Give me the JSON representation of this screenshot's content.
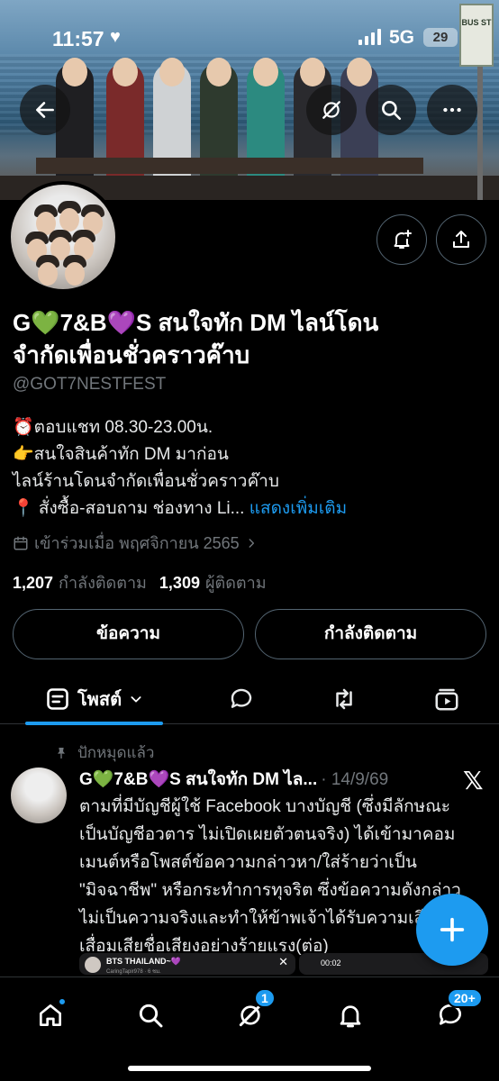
{
  "status_bar": {
    "time": "11:57",
    "network": "5G",
    "battery": "29"
  },
  "profile": {
    "display_name_line1": "G💚7&B💜S สนใจทัก DM ไลน์โดน",
    "display_name_line2": "จำกัดเพื่อนชั่วคราวค๊าบ",
    "handle": "@GOT7NESTFEST",
    "bio_lines": [
      "⏰ตอบแชท 08.30-23.00น.",
      "👉สนใจสินค้าทัก DM มาก่อน",
      "ไลน์ร้านโดนจำกัดเพื่อนชั่วคราวค๊าบ",
      "📍 สั่งซื้อ-สอบถาม ช่องทาง Li..."
    ],
    "show_more": "แสดงเพิ่มเติม",
    "joined": "เข้าร่วมเมื่อ พฤศจิกายน 2565",
    "following_count": "1,207",
    "following_label": "กำลังติดตาม",
    "followers_count": "1,309",
    "followers_label": "ผู้ติดตาม"
  },
  "actions": {
    "message": "ข้อความ",
    "following": "กำลังติดตาม"
  },
  "tabs": {
    "posts": "โพสต์"
  },
  "post": {
    "pinned_label": "ปักหมุดแล้ว",
    "author": "G💚7&B💜S สนใจทัก DM ไล...",
    "date": "14/9/69",
    "text_lines": [
      "ตามที่มีบัญชีผู้ใช้ Facebook บางบัญชี (ซึ่งมีลักษณะ",
      "เป็นบัญชีอวตาร ไม่เปิดเผยตัวตนจริง) ได้เข้ามาคอม",
      "เมนต์หรือโพสต์ข้อความกล่าวหา/ใส่ร้ายว่าเป็น",
      "\"มิจฉาชีพ\" หรือกระทำการทุจริต ซึ่งข้อความดังกล่าว",
      "ไม่เป็นความจริงและทำให้ข้าพเจ้าได้รับความเสียหาย",
      "เสื่อมเสียชื่อเสียงอย่างร้ายแรง(ต่อ)"
    ],
    "preview_1_title": "BTS THAILAND~💜",
    "preview_1_sub": "CaringTapir978 · 6 ชม.",
    "preview_2_time": "00:02"
  },
  "bottom_nav": {
    "grok_badge": "1",
    "messages_badge": "20+"
  },
  "colors": {
    "accent": "#1d9bf0",
    "background": "#000000",
    "secondary_text": "#71767b"
  },
  "icons": [
    "back-arrow-icon",
    "grok-icon",
    "search-icon",
    "more-icon",
    "bell-plus-icon",
    "share-icon",
    "calendar-icon",
    "chevron-right-icon",
    "posts-icon",
    "chevron-down-icon",
    "replies-icon",
    "retweet-icon",
    "media-icon",
    "pin-icon",
    "x-logo-icon",
    "plus-icon",
    "home-icon",
    "notifications-icon",
    "messages-icon"
  ]
}
